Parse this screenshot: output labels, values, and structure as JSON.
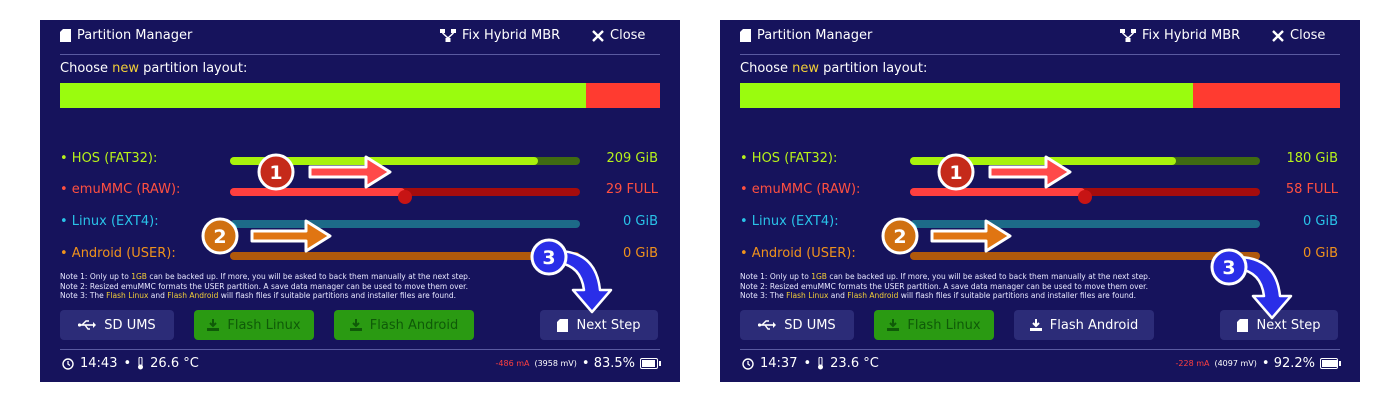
{
  "panels": [
    {
      "header": {
        "title": "Partition Manager",
        "fix_hybrid_mbr": "Fix Hybrid MBR",
        "close": "Close"
      },
      "choose": {
        "prefix": "Choose ",
        "highlight": "new",
        "suffix": " partition layout:"
      },
      "layout_bar": {
        "hos_fraction": 0.876,
        "emummc_fraction": 0.124
      },
      "partitions": [
        {
          "label": "• HOS (FAT32):",
          "value": "209 GiB",
          "slider_fraction": 0.88
        },
        {
          "label": "• emuMMC (RAW):",
          "value": "29 FULL",
          "slider_fraction": 0.5
        },
        {
          "label": "• Linux (EXT4):",
          "value": "0 GiB",
          "slider_fraction": 0.0
        },
        {
          "label": "• Android (USER):",
          "value": "0 GiB",
          "slider_fraction": 0.0
        }
      ],
      "notes": {
        "n1a": "Note 1: Only up to ",
        "n1b": "1GB",
        "n1c": " can be backed up. If more, you will be asked to back them manually at the next step.",
        "n2": "Note 2: Resized emuMMC formats the USER partition. A save data manager can be used to move them over.",
        "n3a": "Note 3: The ",
        "n3b": "Flash Linux",
        "n3c": " and ",
        "n3d": "Flash Android",
        "n3e": " will flash files if suitable partitions and installer files are found."
      },
      "buttons": {
        "ums": "SD UMS",
        "flash_linux": "Flash Linux",
        "flash_android": "Flash Android",
        "next": "Next Step"
      },
      "annotations": {
        "one": "1",
        "two": "2",
        "three": "3"
      },
      "status": {
        "time": "14:43",
        "temp": "26.6 °C",
        "current": "-486 mA",
        "voltage": "(3958 mV)",
        "battery": "• 83.5%",
        "battery_level": 0.835
      }
    },
    {
      "header": {
        "title": "Partition Manager",
        "fix_hybrid_mbr": "Fix Hybrid MBR",
        "close": "Close"
      },
      "choose": {
        "prefix": "Choose ",
        "highlight": "new",
        "suffix": " partition layout:"
      },
      "layout_bar": {
        "hos_fraction": 0.755,
        "emummc_fraction": 0.245
      },
      "partitions": [
        {
          "label": "• HOS (FAT32):",
          "value": "180 GiB",
          "slider_fraction": 0.76
        },
        {
          "label": "• emuMMC (RAW):",
          "value": "58 FULL",
          "slider_fraction": 0.5
        },
        {
          "label": "• Linux (EXT4):",
          "value": "0 GiB",
          "slider_fraction": 0.0
        },
        {
          "label": "• Android (USER):",
          "value": "0 GiB",
          "slider_fraction": 0.0
        }
      ],
      "notes": {
        "n1a": "Note 1: Only up to ",
        "n1b": "1GB",
        "n1c": " can be backed up. If more, you will be asked to back them manually at the next step.",
        "n2": "Note 2: Resized emuMMC formats the USER partition. A save data manager can be used to move them over.",
        "n3a": "Note 3: The ",
        "n3b": "Flash Linux",
        "n3c": " and ",
        "n3d": "Flash Android",
        "n3e": " will flash files if suitable partitions and installer files are found."
      },
      "buttons": {
        "ums": "SD UMS",
        "flash_linux": "Flash Linux",
        "flash_android": "Flash Android",
        "next": "Next Step"
      },
      "annotations": {
        "one": "1",
        "two": "2",
        "three": "3"
      },
      "status": {
        "time": "14:37",
        "temp": "23.6 °C",
        "current": "-228 mA",
        "voltage": "(4097 mV)",
        "battery": "• 92.2%",
        "battery_level": 0.922
      }
    }
  ]
}
